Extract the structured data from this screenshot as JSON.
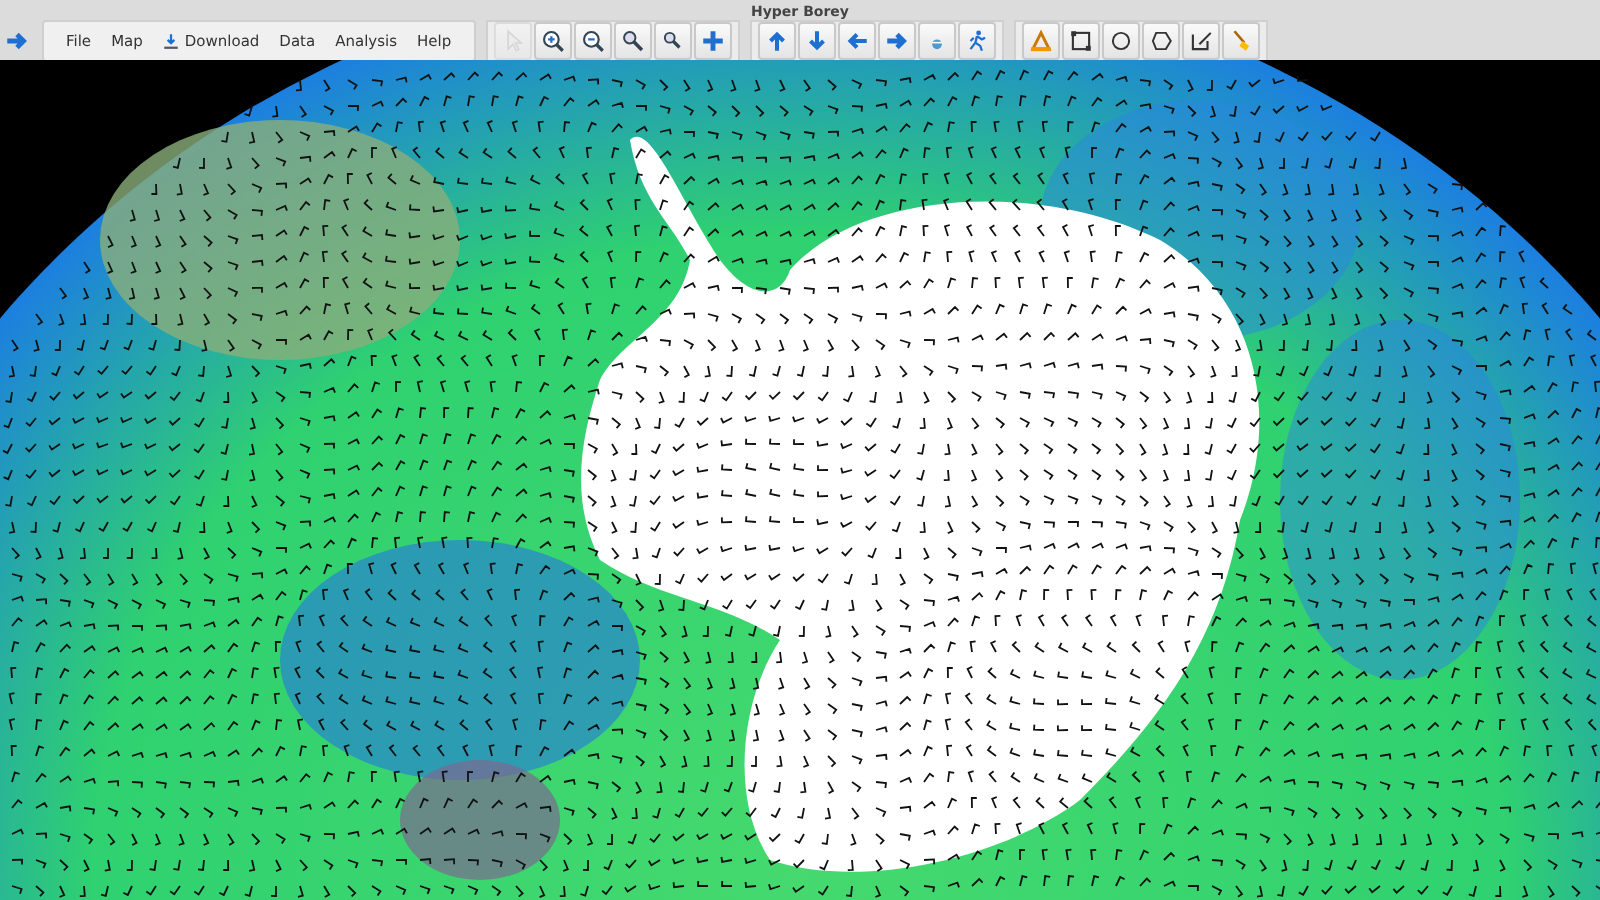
{
  "window": {
    "title": "Hyper Borey"
  },
  "nav_button": {
    "kind": "arrow-right",
    "disabled": false
  },
  "menu": [
    {
      "label": "File",
      "kind": "plain"
    },
    {
      "label": "Map",
      "kind": "plain"
    },
    {
      "label": "Download",
      "kind": "download"
    },
    {
      "label": "Data",
      "kind": "plain"
    },
    {
      "label": "Analysis",
      "kind": "plain"
    },
    {
      "label": "Help",
      "kind": "plain"
    }
  ],
  "toolbar_groups": [
    [
      {
        "kind": "pointer",
        "disabled": true
      },
      {
        "kind": "zoom-in",
        "disabled": false
      },
      {
        "kind": "zoom-out",
        "disabled": false
      },
      {
        "kind": "zoom",
        "disabled": false
      },
      {
        "kind": "zoom-small",
        "disabled": false
      },
      {
        "kind": "pan",
        "disabled": false
      }
    ],
    [
      {
        "kind": "arrow-up",
        "disabled": false
      },
      {
        "kind": "arrow-down",
        "disabled": false
      },
      {
        "kind": "arrow-left",
        "disabled": false
      },
      {
        "kind": "arrow-right",
        "disabled": false
      },
      {
        "kind": "home",
        "disabled": false
      },
      {
        "kind": "runner",
        "disabled": false
      }
    ],
    [
      {
        "kind": "measure",
        "disabled": false
      },
      {
        "kind": "rect-select",
        "disabled": false
      },
      {
        "kind": "circle",
        "disabled": false
      },
      {
        "kind": "polygon",
        "disabled": false
      },
      {
        "kind": "edit",
        "disabled": false
      },
      {
        "kind": "brush",
        "disabled": false
      }
    ]
  ]
}
